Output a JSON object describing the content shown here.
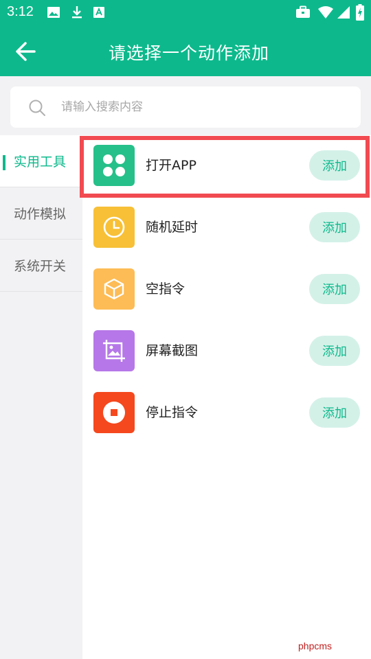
{
  "status_bar": {
    "time": "3:12",
    "icons": [
      "image-icon",
      "download-icon",
      "text-badge-icon",
      "briefcase-icon",
      "wifi-icon",
      "signal-icon",
      "battery-charging-icon"
    ]
  },
  "header": {
    "title": "请选择一个动作添加",
    "back_icon": "arrow-left-icon"
  },
  "search": {
    "placeholder": "请输入搜索内容",
    "value": ""
  },
  "sidebar": {
    "items": [
      {
        "label": "实用工具",
        "active": true
      },
      {
        "label": "动作模拟",
        "active": false
      },
      {
        "label": "系统开关",
        "active": false
      }
    ]
  },
  "actions": {
    "items": [
      {
        "label": "打开APP",
        "icon": "app-grid-icon",
        "color": "#26c08a",
        "button": "添加",
        "highlighted": true
      },
      {
        "label": "随机延时",
        "icon": "clock-icon",
        "color": "#f7c036",
        "button": "添加",
        "highlighted": false
      },
      {
        "label": "空指令",
        "icon": "cube-icon",
        "color": "#fdbc55",
        "button": "添加",
        "highlighted": false
      },
      {
        "label": "屏幕截图",
        "icon": "screenshot-icon",
        "color": "#b678e8",
        "button": "添加",
        "highlighted": false
      },
      {
        "label": "停止指令",
        "icon": "stop-icon",
        "color": "#f5481e",
        "button": "添加",
        "highlighted": false
      }
    ]
  },
  "colors": {
    "primary": "#0db98c",
    "highlight_border": "#f24a51"
  },
  "watermark": "phpcms"
}
